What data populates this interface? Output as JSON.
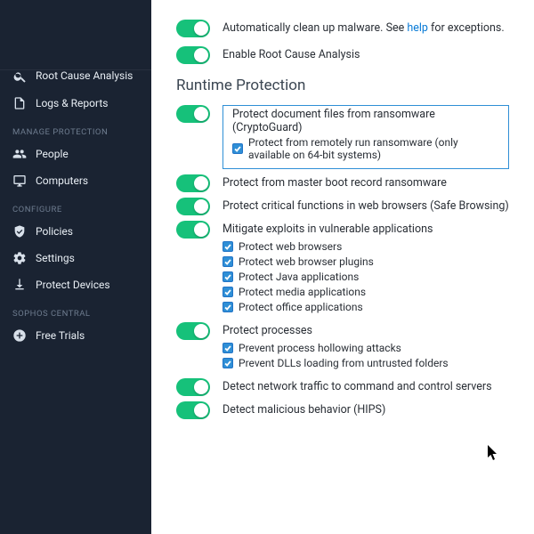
{
  "sidebar": {
    "item_root_cause": "Root Cause Analysis",
    "item_logs_reports": "Logs & Reports",
    "heading_manage": "Manage Protection",
    "item_people": "People",
    "item_computers": "Computers",
    "heading_configure": "Configure",
    "item_policies": "Policies",
    "item_settings": "Settings",
    "item_protect_devices": "Protect Devices",
    "heading_central": "Sophos Central",
    "item_free_trials": "Free Trials"
  },
  "main": {
    "toggle_cleanup_pre": "Automatically clean up malware. See ",
    "toggle_cleanup_link": "help",
    "toggle_cleanup_post": " for exceptions.",
    "toggle_rca": "Enable Root Cause Analysis",
    "section_runtime": "Runtime Protection",
    "crypto_title": "Protect document files from ransomware (CryptoGuard)",
    "crypto_sub": "Protect from remotely run ransomware (only available on 64-bit systems)",
    "mbr": "Protect from master boot record ransomware",
    "safe_browsing": "Protect critical functions in web browsers (Safe Browsing)",
    "mitigate": "Mitigate exploits in vulnerable applications",
    "m1": "Protect web browsers",
    "m2": "Protect web browser plugins",
    "m3": "Protect Java applications",
    "m4": "Protect media applications",
    "m5": "Protect office applications",
    "processes": "Protect processes",
    "p1": "Prevent process hollowing attacks",
    "p2": "Prevent DLLs loading from untrusted folders",
    "c2": "Detect network traffic to command and control servers",
    "hips": "Detect malicious behavior (HIPS)"
  }
}
